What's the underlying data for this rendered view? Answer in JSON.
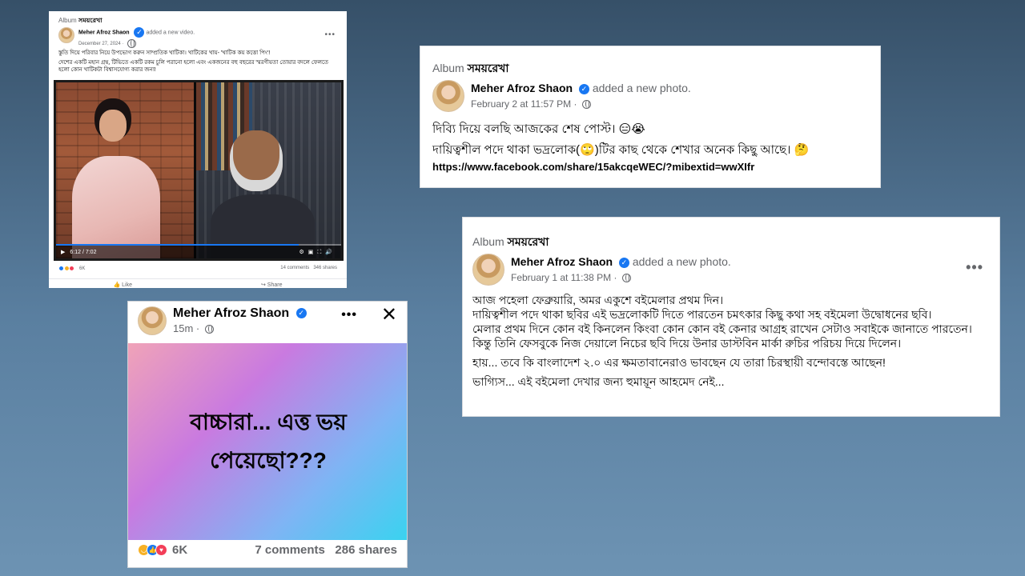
{
  "colors": {
    "facebook_blue": "#1877f2",
    "meta_gray": "#65676b",
    "reaction_haha": "#f7b125",
    "reaction_love": "#f33e58"
  },
  "post_video": {
    "album_prefix": "Album",
    "album_name": "সময়রেখা",
    "author": "Meher Afroz Shaon",
    "action": "added a new video.",
    "date": "December 27, 2024 ·",
    "para1": "স্তুতি দিয়ে পরিবার নিয়ে উপভোগ করুন সাম্প্রতিক খাটিকা। খাটিকের খায়- 'খাটিক কয় কত্তো পিং'!",
    "para2": "দেশের একটি মহান গ্রন্থ, টিভিতে একটি রকম চুলি পরানো হলো এবং একজনের বহু বছরের স্মরণীয়তা তোয়ার বদলে ফেলতে হলো কোন খাটিকটা বিশ্বাসযোগ্য করার জন্য!",
    "time": "6:12 / 7:02",
    "progress_fraction": 0.85,
    "reactions_count": "6K",
    "comments": "14 comments",
    "shares": "346 shares",
    "like_label": "Like",
    "share_label": "Share"
  },
  "post_photo_1": {
    "album_prefix": "Album",
    "album_name": "সময়রেখা",
    "author": "Meher Afroz Shaon",
    "action": "added a new photo.",
    "date": "February 2 at 11:57 PM ·",
    "line1": "দিব্যি দিয়ে বলছি আজকের শেষ পোস্ট। 😑😭",
    "line2": "দায়িত্বশীল পদে থাকা ভদ্রলোক(🙄)টির কাছ থেকে শেখার অনেক কিছু আছে। 🤔",
    "link": "https://www.facebook.com/share/15akcqeWEC/?mibextid=wwXIfr"
  },
  "post_photo_2": {
    "album_prefix": "Album",
    "album_name": "সময়রেখা",
    "author": "Meher Afroz Shaon",
    "action": "added a new photo.",
    "date": "February 1 at 11:38 PM ·",
    "lines": [
      "আজ পহেলা ফেব্রুয়ারি, অমর একুশে বইমেলার প্রথম দিন।",
      "দায়িত্বশীল পদে থাকা ছবির এই ভদ্রলোকটি দিতে পারতেন চমৎকার কিছু কথা সহ বইমেলা উদ্বোধনের ছবি।",
      "মেলার প্রথম দিনে কোন বই কিনলেন কিংবা কোন কোন বই কেনার আগ্রহ রাখেন সেটাও সবাইকে জানাতে পারতেন।",
      "কিন্তু তিনি ফেসবুকে নিজ দেয়ালে নিচের ছবি দিয়ে উনার ডাস্টবিন মার্কা রুচির পরিচয় দিয়ে দিলেন।",
      "হায়... তবে কি বাংলাদেশ ২.০ এর ক্ষমতাবানেরাও ভাবছেন যে তারা চিরস্থায়ী বন্দোবস্তে আছেন!",
      "ভাগ্যিস... এই বইমেলা দেখার জন্য হুমায়ূন আহমেদ নেই..."
    ]
  },
  "post_status": {
    "author": "Meher Afroz Shaon",
    "time": "15m ·",
    "line1": "বাচ্চারা... এত্ত ভয়",
    "line2": "পেয়েছো???",
    "reactions_count": "6K",
    "comments": "7 comments",
    "shares": "286 shares"
  }
}
